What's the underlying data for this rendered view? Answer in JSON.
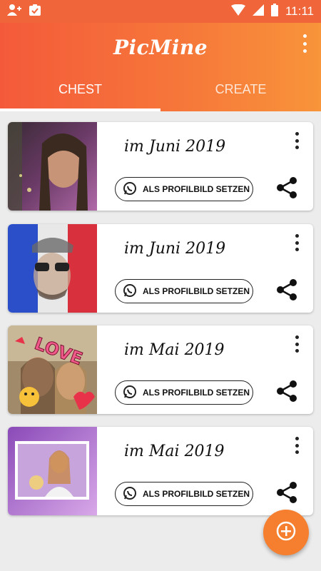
{
  "status_bar": {
    "time": "11:11"
  },
  "app": {
    "title": "PicMine"
  },
  "tabs": [
    {
      "label": "CHEST",
      "selected": true
    },
    {
      "label": "CREATE",
      "selected": false
    }
  ],
  "cards": [
    {
      "date": "im Juni 2019",
      "button_label": "ALS PROFILBILD SETZEN"
    },
    {
      "date": "im Juni 2019",
      "button_label": "ALS PROFILBILD SETZEN"
    },
    {
      "date": "im Mai 2019",
      "button_label": "ALS PROFILBILD SETZEN",
      "overlay_text": "LOVE"
    },
    {
      "date": "im Mai 2019",
      "button_label": "ALS PROFILBILD SETZEN"
    }
  ],
  "colors": {
    "accent": "#f6763a",
    "fab": "#f57f2e"
  }
}
